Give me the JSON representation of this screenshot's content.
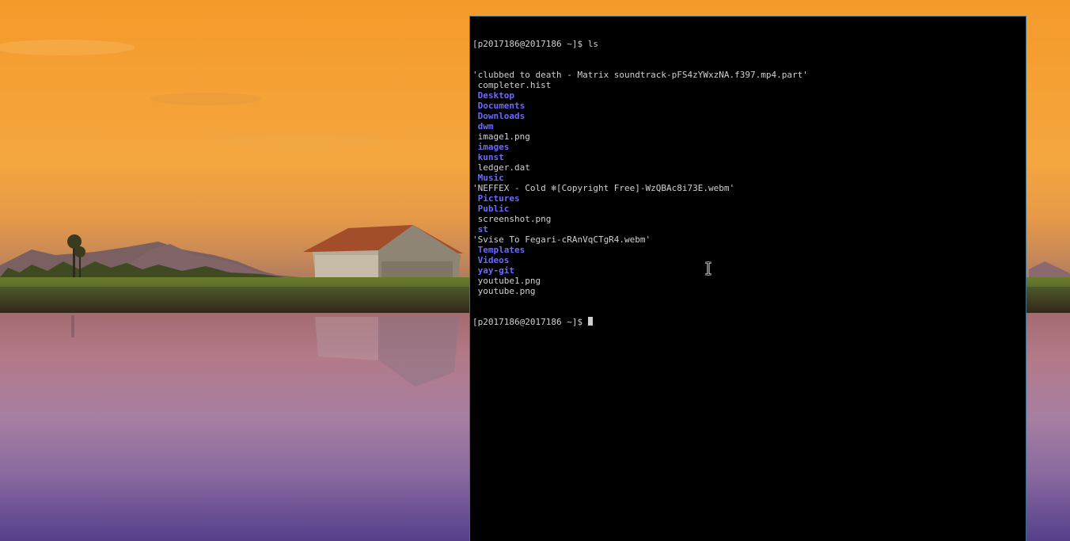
{
  "terminal": {
    "prompt": "[p2017186@2017186 ~]$ ",
    "command": "ls",
    "entries": [
      {
        "name": "'clubbed to death - Matrix soundtrack-pFS4zYWxzNA.f397.mp4.part'",
        "type": "file"
      },
      {
        "name": " completer.hist",
        "type": "file"
      },
      {
        "name": " Desktop",
        "type": "dir"
      },
      {
        "name": " Documents",
        "type": "dir"
      },
      {
        "name": " Downloads",
        "type": "dir"
      },
      {
        "name": " dwm",
        "type": "dir"
      },
      {
        "name": " image1.png",
        "type": "file"
      },
      {
        "name": " images",
        "type": "dir"
      },
      {
        "name": " kunst",
        "type": "dir"
      },
      {
        "name": " ledger.dat",
        "type": "file"
      },
      {
        "name": " Music",
        "type": "dir"
      },
      {
        "name": "'NEFFEX - Cold ❄[Copyright Free]-WzQBAc8i73E.webm'",
        "type": "file"
      },
      {
        "name": " Pictures",
        "type": "dir"
      },
      {
        "name": " Public",
        "type": "dir"
      },
      {
        "name": " screenshot.png",
        "type": "file"
      },
      {
        "name": " st",
        "type": "dir"
      },
      {
        "name": "'Svise To Fegari-cRAnVqCTgR4.webm'",
        "type": "file"
      },
      {
        "name": " Templates",
        "type": "dir"
      },
      {
        "name": " Videos",
        "type": "dir"
      },
      {
        "name": " yay-git",
        "type": "dir"
      },
      {
        "name": " youtube1.png",
        "type": "file"
      },
      {
        "name": " youtube.png",
        "type": "file"
      }
    ],
    "colors": {
      "background": "#000000",
      "text": "#d0d0d0",
      "directory": "#6a6aff",
      "border": "#3a6f8f"
    }
  },
  "desktop": {
    "wallpaper": "sunset lake with house",
    "mouse_cursor_icon": "text-ibeam-icon"
  }
}
